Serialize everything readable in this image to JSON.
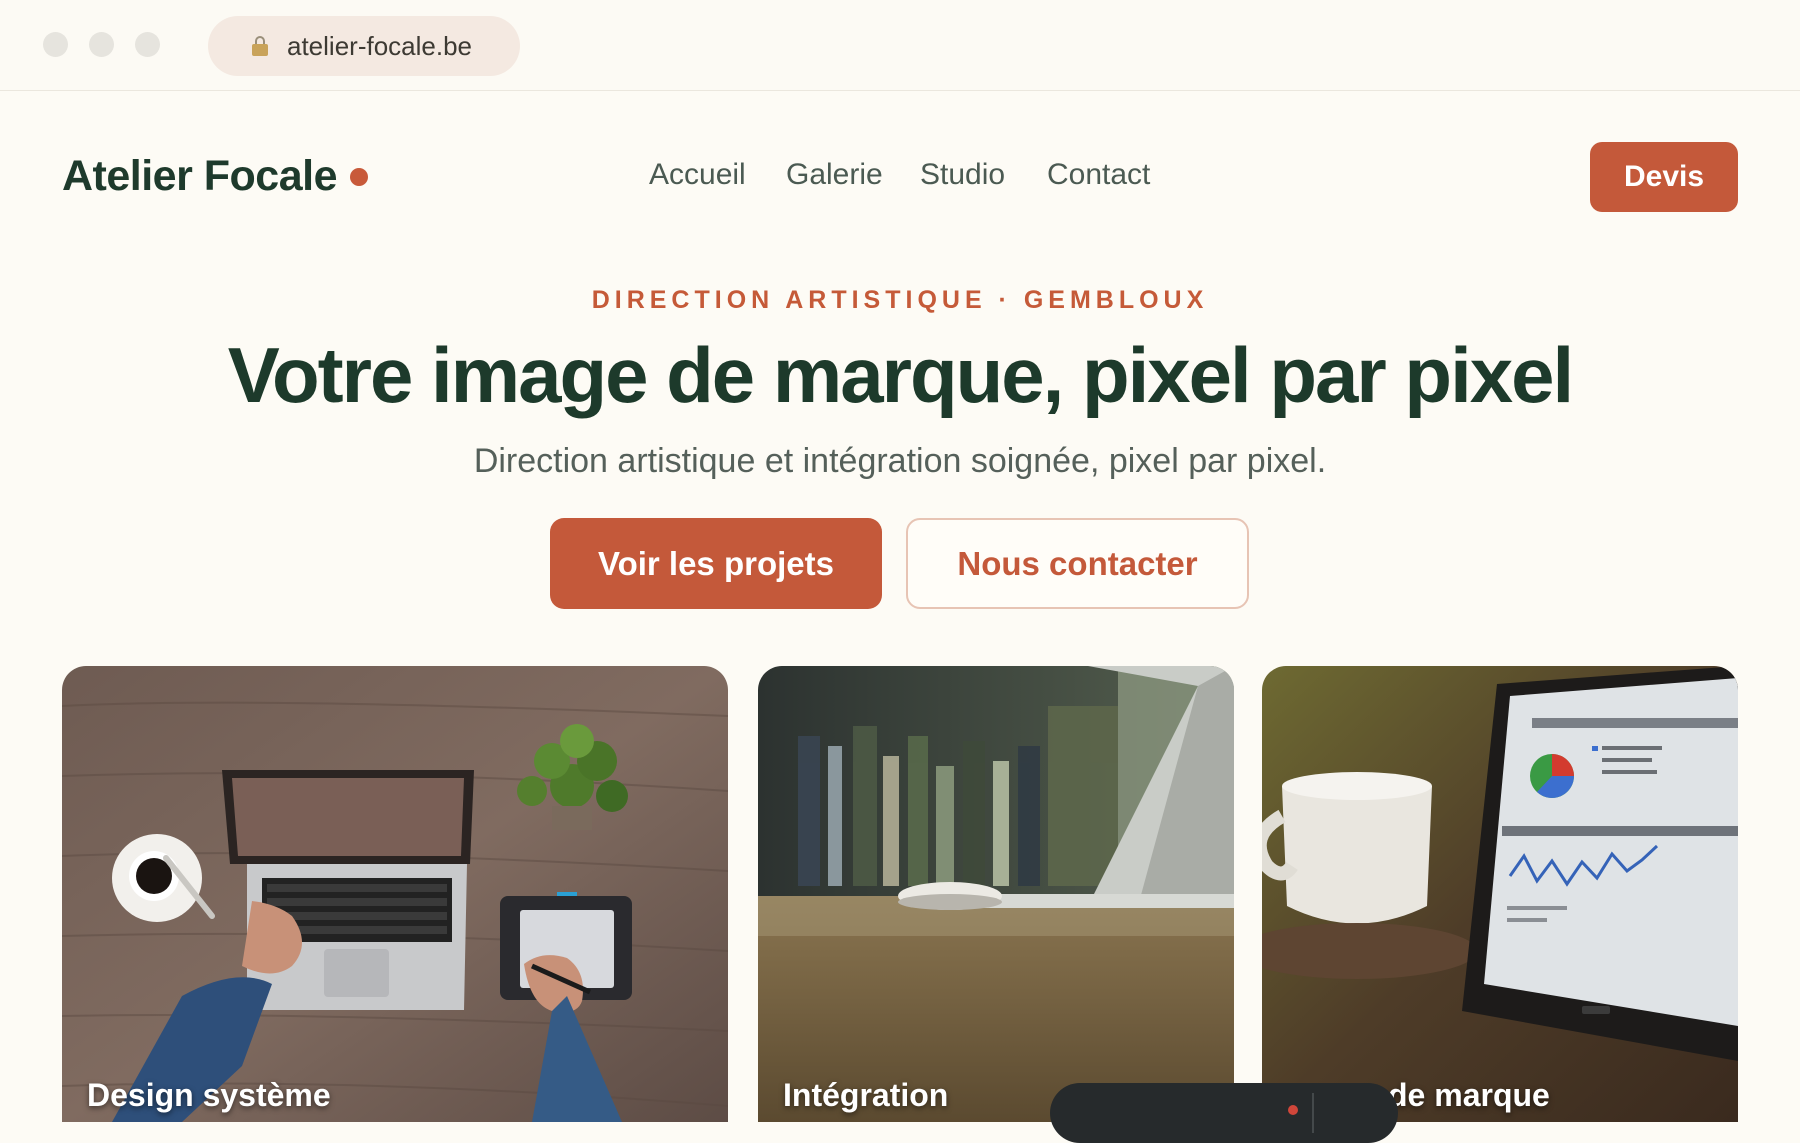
{
  "browser": {
    "url": "atelier-focale.be"
  },
  "nav": {
    "logo": "Atelier Focale",
    "links": [
      "Accueil",
      "Galerie",
      "Studio",
      "Contact"
    ],
    "cta": "Devis"
  },
  "hero": {
    "eyebrow": "DIRECTION ARTISTIQUE · GEMBLOUX",
    "title": "Votre image de marque, pixel par pixel",
    "subtitle": "Direction artistique et intégration soignée, pixel par pixel.",
    "primary_button": "Voir les projets",
    "secondary_button": "Nous contacter"
  },
  "cards": [
    {
      "label": "Design système"
    },
    {
      "label": "Intégration"
    },
    {
      "label": "de marque"
    }
  ],
  "colors": {
    "accent": "#c4593a",
    "brand_dark": "#1d3a2b",
    "background": "#fdfbf5"
  }
}
